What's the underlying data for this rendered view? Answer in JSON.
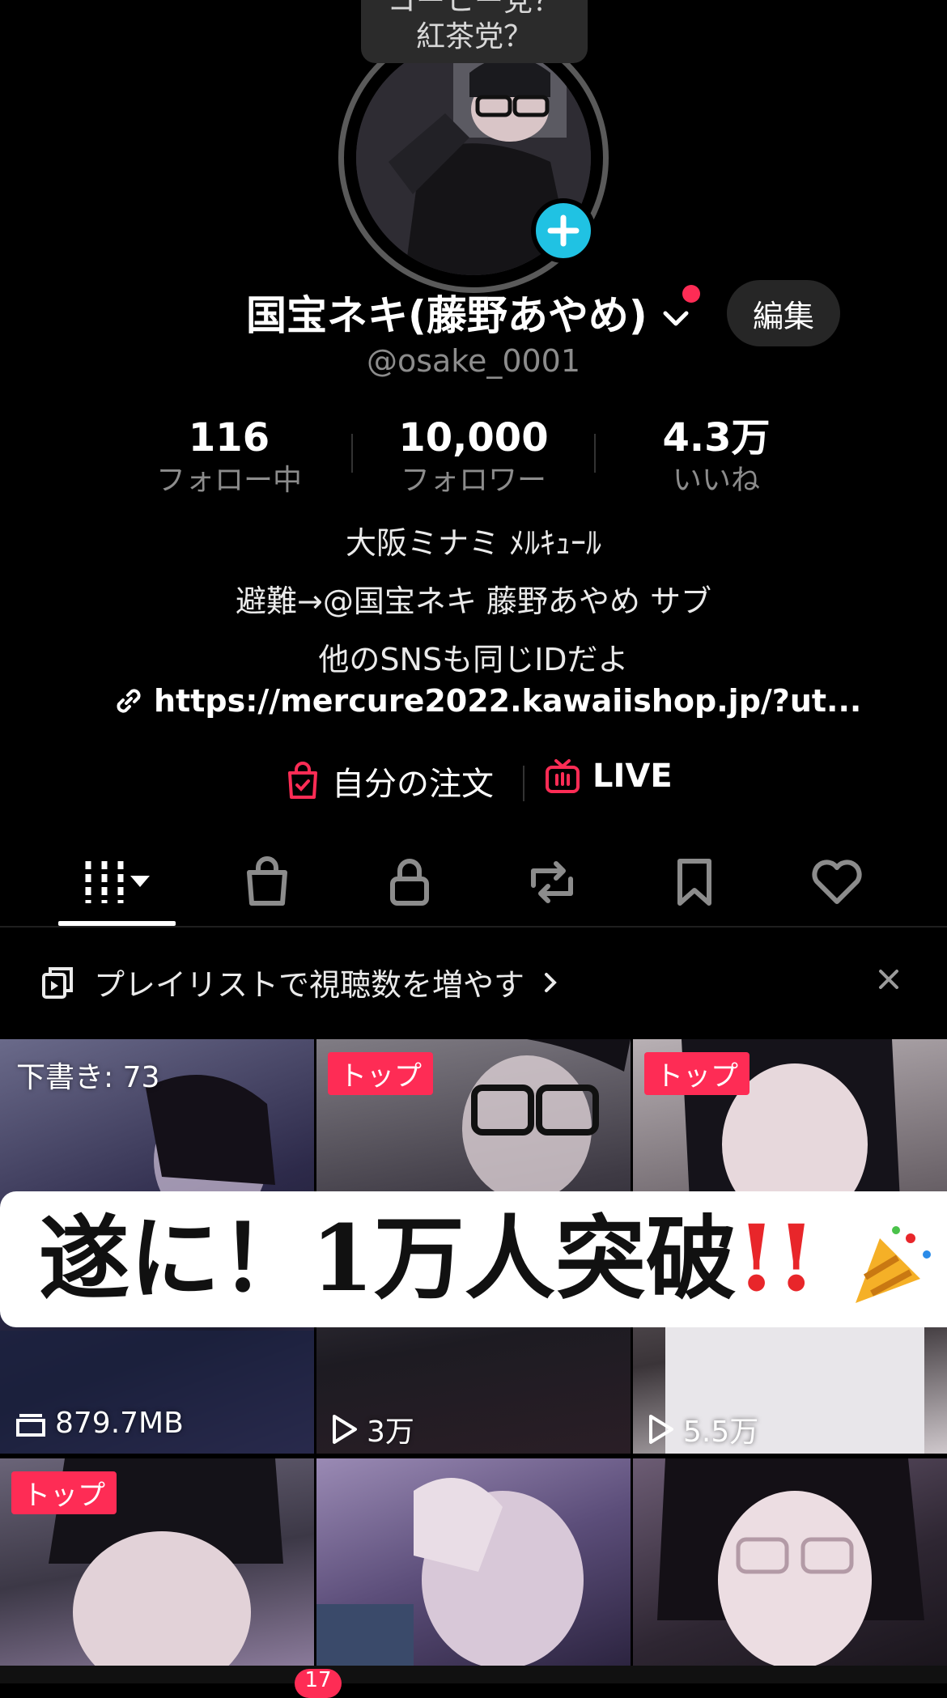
{
  "bubble": {
    "line1": "コーヒー党？",
    "line2": "紅茶党？"
  },
  "profile": {
    "name": "国宝ネキ(藤野あやめ)",
    "handle": "@osake_0001",
    "edit_label": "編集"
  },
  "stats": [
    {
      "value": "116",
      "label": "フォロー中"
    },
    {
      "value": "10,000",
      "label": "フォロワー"
    },
    {
      "value": "4.3万",
      "label": "いいね"
    }
  ],
  "bio": {
    "line1": "大阪ミナミ ﾒﾙｷｭｰﾙ",
    "line2": "避難→@国宝ネキ 藤野あやめ サブ",
    "line3": "他のSNSも同じIDだよ",
    "link": "https://mercure2022.kawaiishop.jp/?ut..."
  },
  "shortcuts": {
    "orders": "自分の注文",
    "live": "LIVE"
  },
  "colors": {
    "accent": "#fe2c55",
    "add": "#20c2e3",
    "background": "#000000"
  },
  "tabs": [
    "videos-icon",
    "shop-icon",
    "lock-icon",
    "repost-icon",
    "bookmark-icon",
    "heart-icon"
  ],
  "playlist": {
    "text": "プレイリストで視聴数を増やす"
  },
  "grid": {
    "tiles": [
      {
        "badge": "",
        "top_text": "下書き: 73",
        "bottom_text": "879.7MB"
      },
      {
        "badge": "トップ",
        "top_text": "",
        "bottom_text": "3万"
      },
      {
        "badge": "トップ",
        "top_text": "",
        "bottom_text": "5.5万"
      },
      {
        "badge": "トップ",
        "top_text": "",
        "bottom_text": ""
      },
      {
        "badge": "",
        "top_text": "",
        "bottom_text": ""
      },
      {
        "badge": "",
        "top_text": "",
        "bottom_text": ""
      }
    ],
    "banner_text": "遂に！1万人突破",
    "banner_marks": "!!"
  },
  "bottom_nav": {
    "inbox_badge": "17"
  }
}
